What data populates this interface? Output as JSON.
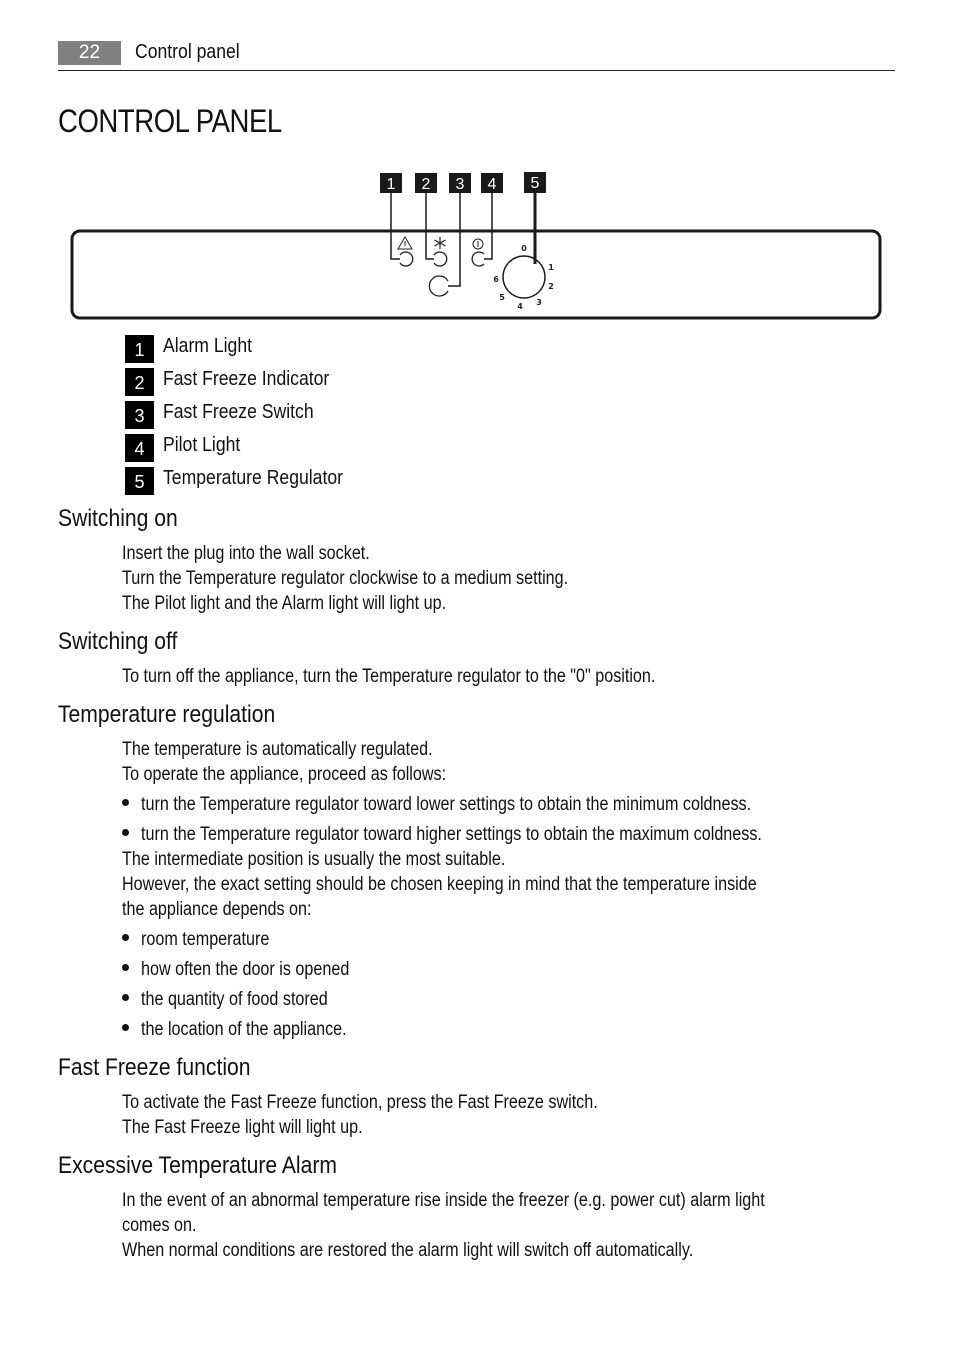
{
  "header": {
    "page_number": "22",
    "running_head": "Control panel"
  },
  "title": "CONTROL PANEL",
  "diagram": {
    "callouts": [
      "1",
      "2",
      "3",
      "4",
      "5"
    ],
    "dial_marks": [
      "0",
      "1",
      "2",
      "3",
      "4",
      "5",
      "6"
    ],
    "icons": [
      "alarm-warning-icon",
      "snowflake-icon",
      "power-icon"
    ]
  },
  "legend": [
    {
      "number": "1",
      "label": "Alarm Light"
    },
    {
      "number": "2",
      "label": "Fast Freeze Indicator"
    },
    {
      "number": "3",
      "label": "Fast Freeze Switch"
    },
    {
      "number": "4",
      "label": "Pilot Light"
    },
    {
      "number": "5",
      "label": "Temperature Regulator"
    }
  ],
  "sections": {
    "switching_on": {
      "title": "Switching on",
      "lines": [
        "Insert the plug into the wall socket.",
        "Turn the Temperature regulator clockwise to a medium setting.",
        "The Pilot light and the Alarm light will light up."
      ]
    },
    "switching_off": {
      "title": "Switching off",
      "lines": [
        "To turn off the appliance, turn the Temperature regulator to the \"0\" position."
      ]
    },
    "temperature_regulation": {
      "title": "Temperature regulation",
      "intro": [
        "The temperature is automatically regulated.",
        "To operate the appliance, proceed as follows:"
      ],
      "steps": [
        "turn the Temperature regulator toward lower settings to obtain the minimum coldness.",
        "turn the Temperature regulator toward higher settings to obtain the maximum coldness."
      ],
      "middle": [
        "The intermediate position is usually the most suitable.",
        "However, the exact setting should be chosen keeping in mind that the temperature inside",
        "the appliance depends on:"
      ],
      "factors": [
        "room temperature",
        "how often the door is opened",
        "the quantity of food stored",
        "the location of the appliance."
      ]
    },
    "fast_freeze": {
      "title": "Fast Freeze function",
      "lines": [
        "To activate the Fast Freeze function, press the Fast Freeze switch.",
        "The Fast Freeze light will light up."
      ]
    },
    "alarm": {
      "title": "Excessive Temperature Alarm",
      "lines": [
        "In the event of an abnormal temperature rise inside the freezer (e.g. power cut) alarm light",
        "comes on.",
        "When normal conditions are restored the alarm light will switch off automatically."
      ]
    }
  }
}
